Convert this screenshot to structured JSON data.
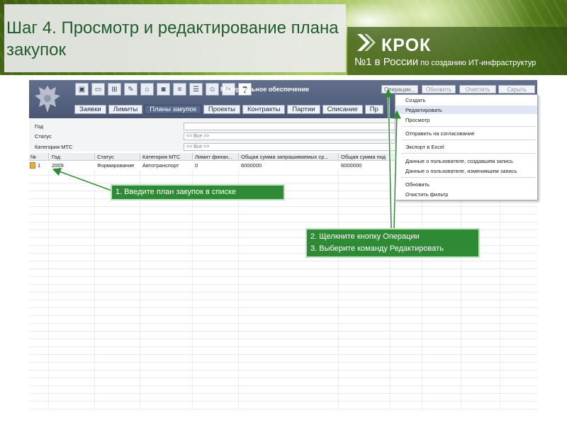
{
  "slide": {
    "title": "Шаг 4. Просмотр и редактирование плана закупок",
    "logo": {
      "name": "КРОК",
      "tagline_big": "№1 в России",
      "tagline_rest": " по созданию ИТ-инфраструктур"
    }
  },
  "app": {
    "title": "Материальное обеспечение",
    "top_buttons": [
      "Операции...",
      "Обновить",
      "Очистить",
      "Скрыть"
    ],
    "tabs": [
      "Заявки",
      "Лимиты",
      "Планы закупок",
      "Проекты",
      "Контракты",
      "Партии",
      "Списание",
      "Пр"
    ],
    "active_tab": "Планы закупок",
    "filters": [
      {
        "label": "Год",
        "value": ""
      },
      {
        "label": "Статус",
        "value": "<< Все >>"
      },
      {
        "label": "Категория МТС",
        "value": "<< Все >>"
      }
    ],
    "table": {
      "columns": [
        "№",
        "Год",
        "Статус",
        "Категория МТС",
        "Лимит финан...",
        "Общая сумма запрашиваемых ср...",
        "Общая сумма под"
      ],
      "rows": [
        [
          "1",
          "2009",
          "Формирование",
          "Автотранспорт",
          "0",
          "6000000",
          "6000000"
        ]
      ]
    },
    "operations_menu": [
      "Создать",
      "Редактировать",
      "Просмотр",
      "Отправить на согласование",
      "Экспорт в Excel",
      "Данные о пользователе, создавшем запись",
      "Данные о пользователе, изменившем запись",
      "Обновить",
      "Очистить фильтр"
    ],
    "highlighted_menu_item": "Редактировать"
  },
  "callouts": {
    "step1": "1. Введите план закупок в списке",
    "step2": "2. Щелкните кнопку Операции",
    "step3": "3. Выберите команду Редактировать"
  },
  "colors": {
    "title_text": "#1f5d2e",
    "callout_bg": "#2f8a36",
    "app_header": "#4a5674"
  }
}
